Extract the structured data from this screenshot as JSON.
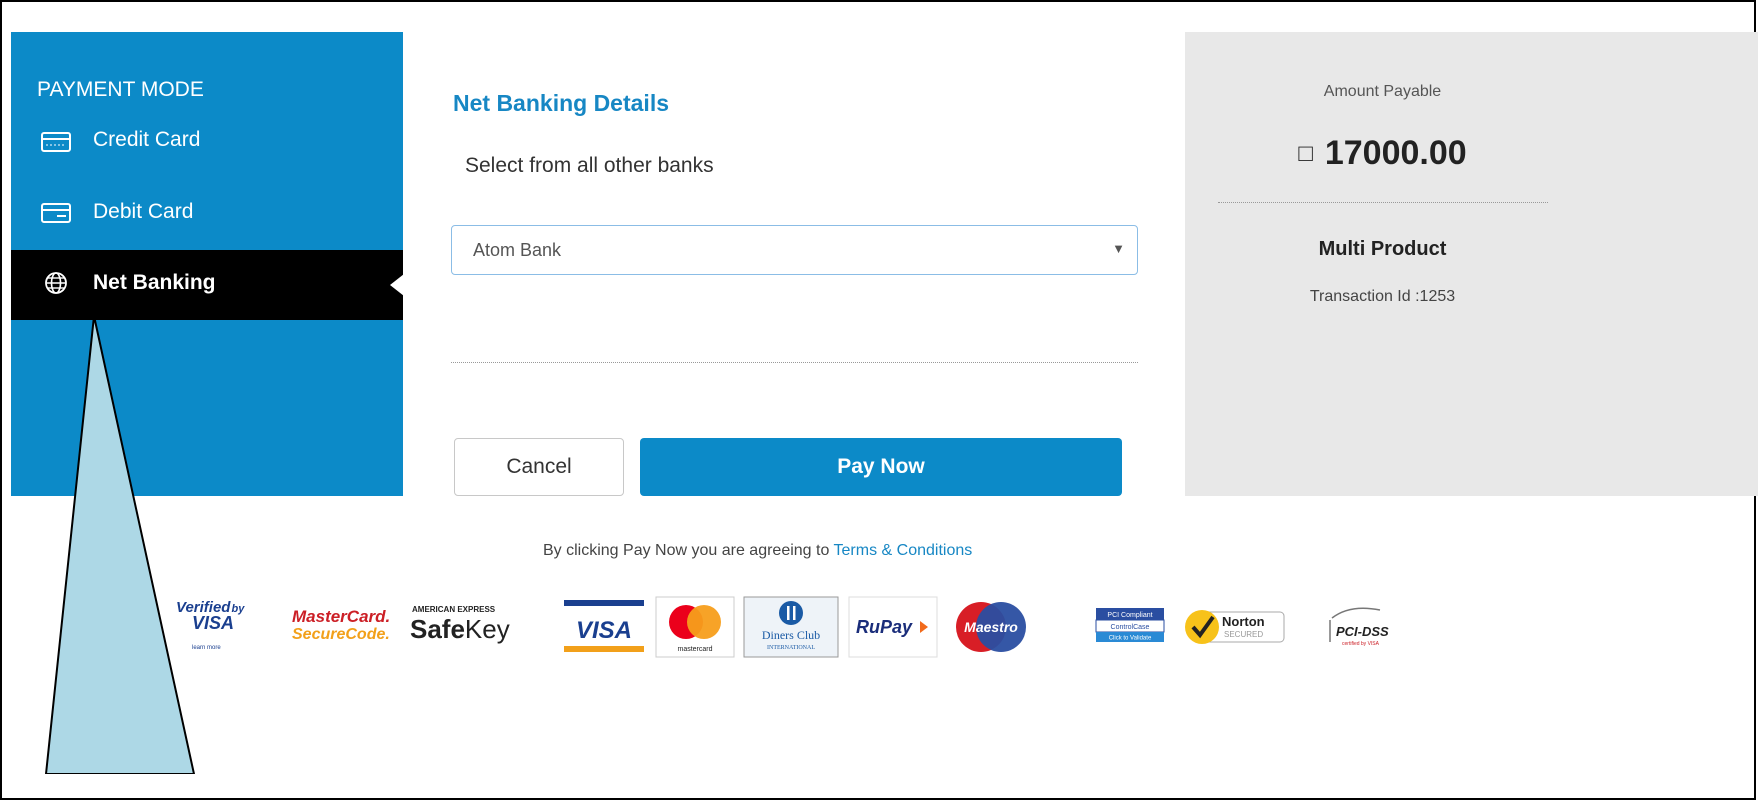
{
  "sidebar": {
    "title": "PAYMENT MODE",
    "items": [
      {
        "label": "Credit Card",
        "icon": "credit-card-icon"
      },
      {
        "label": "Debit Card",
        "icon": "debit-card-icon"
      },
      {
        "label": "Net Banking",
        "icon": "globe-icon",
        "active": true
      }
    ]
  },
  "main": {
    "title": "Net Banking Details",
    "subtitle": "Select from all other banks",
    "bank_select": {
      "value": "Atom Bank"
    },
    "cancel_label": "Cancel",
    "pay_label": "Pay Now"
  },
  "summary": {
    "amount_label": "Amount Payable",
    "currency_symbol": "□",
    "amount": "17000.00",
    "product": "Multi Product",
    "transaction": "Transaction Id :1253"
  },
  "footer": {
    "agree_text": "By clicking Pay Now you are agreeing to ",
    "terms_link": "Terms & Conditions",
    "logos": {
      "verified_visa_1": "Verified",
      "verified_visa_by": "by",
      "verified_visa_2": "VISA",
      "verified_visa_3": "learn more",
      "mastercard_sc_1": "MasterCard.",
      "mastercard_sc_2": "SecureCode.",
      "amex_1": "AMERICAN EXPRESS",
      "amex_2a": "Safe",
      "amex_2b": "Key",
      "visa": "VISA",
      "mastercard": "mastercard",
      "diners_1": "Diners Club",
      "diners_2": "INTERNATIONAL",
      "rupay": "RuPay",
      "maestro": "Maestro",
      "pci_compliant_1": "PCI Compliant",
      "pci_compliant_2": "ControlCase",
      "pci_compliant_3": "Click to Validate",
      "norton_1": "Norton",
      "norton_2": "SECURED",
      "pcidss_1": "PCI-DSS",
      "pcidss_2": "certified by VISA"
    }
  }
}
